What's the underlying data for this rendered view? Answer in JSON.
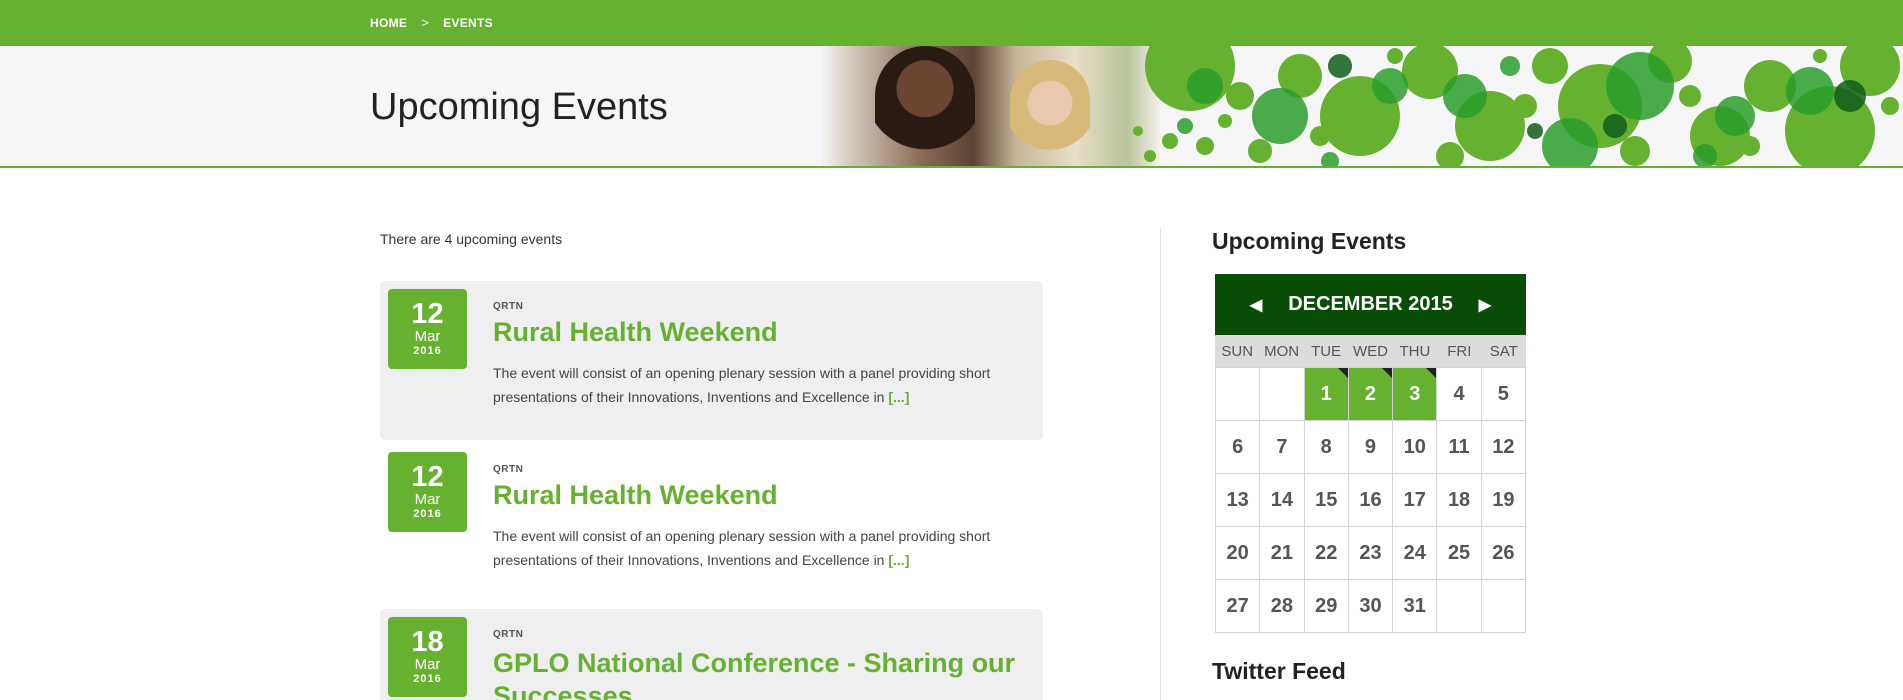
{
  "breadcrumb": {
    "home": "HOME",
    "separator": ">",
    "current": "EVENTS"
  },
  "banner": {
    "title": "Upcoming Events"
  },
  "main": {
    "count_text": "There are 4 upcoming events",
    "events": [
      {
        "day": "12",
        "month": "Mar",
        "year": "2016",
        "category": "QRTN",
        "title": "Rural Health Weekend",
        "description": "The event will consist of an opening plenary session with a panel providing short presentations of their Innovations, Inventions and Excellence in",
        "more": "[...]"
      },
      {
        "day": "12",
        "month": "Mar",
        "year": "2016",
        "category": "QRTN",
        "title": "Rural Health Weekend",
        "description": "The event will consist of an opening plenary session with a panel providing short presentations of their Innovations, Inventions and Excellence in",
        "more": "[...]"
      },
      {
        "day": "18",
        "month": "Mar",
        "year": "2016",
        "category": "QRTN",
        "title": "GPLO National Conference - Sharing our Successes",
        "description": "",
        "more": ""
      }
    ]
  },
  "sidebar": {
    "calendar_heading": "Upcoming Events",
    "calendar": {
      "month_label": "DECEMBER 2015",
      "prev": "◀",
      "next": "▶",
      "weekdays": [
        "SUN",
        "MON",
        "TUE",
        "WED",
        "THU",
        "FRI",
        "SAT"
      ],
      "cells": [
        "",
        "",
        "1",
        "2",
        "3",
        "4",
        "5",
        "6",
        "7",
        "8",
        "9",
        "10",
        "11",
        "12",
        "13",
        "14",
        "15",
        "16",
        "17",
        "18",
        "19",
        "20",
        "21",
        "22",
        "23",
        "24",
        "25",
        "26",
        "27",
        "28",
        "29",
        "30",
        "31",
        "",
        ""
      ],
      "event_days": [
        "1",
        "2",
        "3"
      ]
    },
    "twitter_heading": "Twitter Feed"
  },
  "colors": {
    "brand_green": "#66b12f",
    "dark_green": "#0a4d06"
  }
}
